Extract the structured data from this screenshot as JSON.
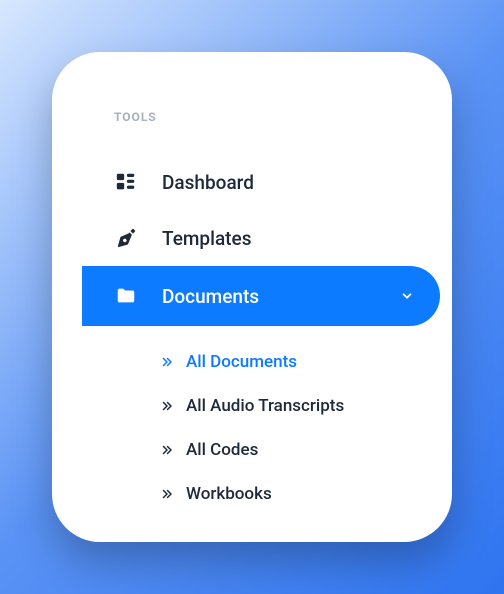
{
  "section_title": "TOOLS",
  "nav": {
    "dashboard": {
      "label": "Dashboard",
      "icon": "dashboard-icon"
    },
    "templates": {
      "label": "Templates",
      "icon": "pen-nib-icon"
    },
    "documents": {
      "label": "Documents",
      "icon": "folder-icon",
      "expanded": true,
      "active": true
    }
  },
  "documents_sub": [
    {
      "label": "All Documents",
      "active": true
    },
    {
      "label": "All Audio Transcripts",
      "active": false
    },
    {
      "label": "All Codes",
      "active": false
    },
    {
      "label": "Workbooks",
      "active": false
    }
  ],
  "colors": {
    "accent": "#0d7bff",
    "text": "#1e2939",
    "muted": "#a8b0bd"
  }
}
